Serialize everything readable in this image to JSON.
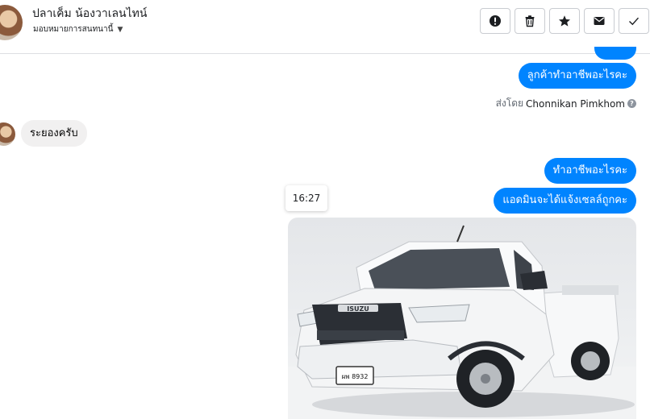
{
  "header": {
    "contact_name": "ปลาเค็ม น้องวาเลนไทน์",
    "assign_label": "มอบหมายการสนทนานี้",
    "actions": [
      {
        "name": "mark-spam-button",
        "icon": "alert-circle-icon"
      },
      {
        "name": "delete-button",
        "icon": "trash-icon"
      },
      {
        "name": "star-button",
        "icon": "star-icon"
      },
      {
        "name": "mark-unread-button",
        "icon": "envelope-icon"
      },
      {
        "name": "mark-done-button",
        "icon": "check-icon"
      }
    ]
  },
  "messages": {
    "out_1": "ลูกค้าทำอาชีพอะไรคะ",
    "sent_by_prefix": "ส่งโดย",
    "sent_by_name": "Chonnikan Pimkhom",
    "in_1": "ระยองครับ",
    "out_2": "ทำอาชีพอะไรคะ",
    "timestamp": "16:27",
    "out_3": "แอดมินจะได้แจ้งเซลล์ถูกคะ"
  },
  "photo": {
    "brand_text": "ISUZU",
    "plate_text": "ผพ 8932"
  },
  "colors": {
    "outgoing_bubble": "#0084ff",
    "incoming_bubble": "#f1f0f0",
    "header_border": "#dddfe2"
  }
}
